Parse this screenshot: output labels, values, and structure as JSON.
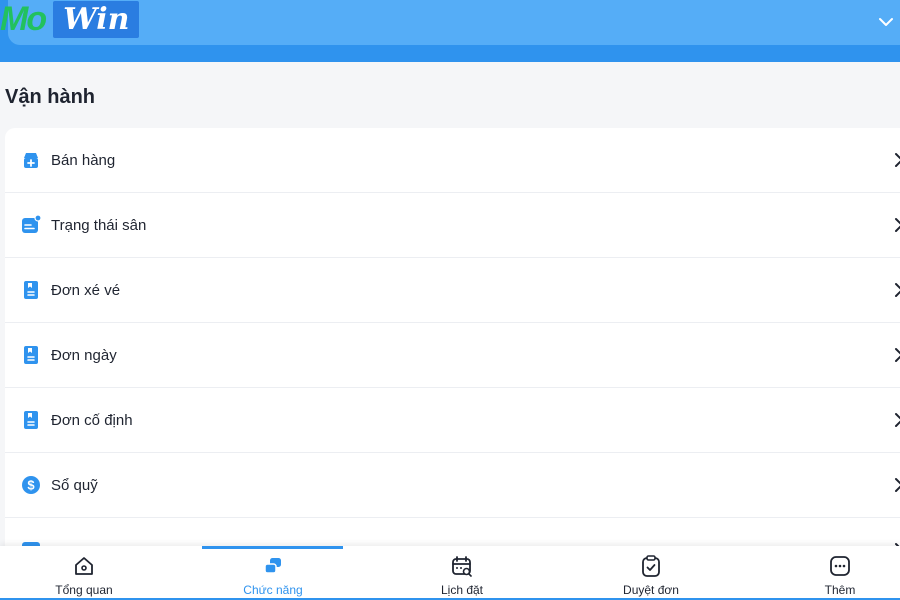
{
  "header": {
    "logo_left": "Mo",
    "logo_right": "Win"
  },
  "section": {
    "title": "Vận hành"
  },
  "menu": {
    "items": [
      {
        "label": "Bán hàng",
        "icon": "shop-icon"
      },
      {
        "label": "Trạng thái sân",
        "icon": "court-status-icon"
      },
      {
        "label": "Đơn xé vé",
        "icon": "ticket-order-icon"
      },
      {
        "label": "Đơn ngày",
        "icon": "daily-order-icon"
      },
      {
        "label": "Đơn cố định",
        "icon": "fixed-order-icon"
      },
      {
        "label": "Sổ quỹ",
        "icon": "dollar-icon"
      }
    ]
  },
  "nav": {
    "items": [
      {
        "label": "Tổng quan",
        "icon": "home-icon"
      },
      {
        "label": "Chức năng",
        "icon": "functions-icon",
        "active": true
      },
      {
        "label": "Lịch đặt",
        "icon": "calendar-icon"
      },
      {
        "label": "Duyệt đơn",
        "icon": "clipboard-check-icon"
      },
      {
        "label": "Thêm",
        "icon": "more-icon"
      }
    ]
  },
  "colors": {
    "accent": "#2f93ee",
    "header_bar": "#55adf7",
    "logo_green": "#22c15e"
  }
}
